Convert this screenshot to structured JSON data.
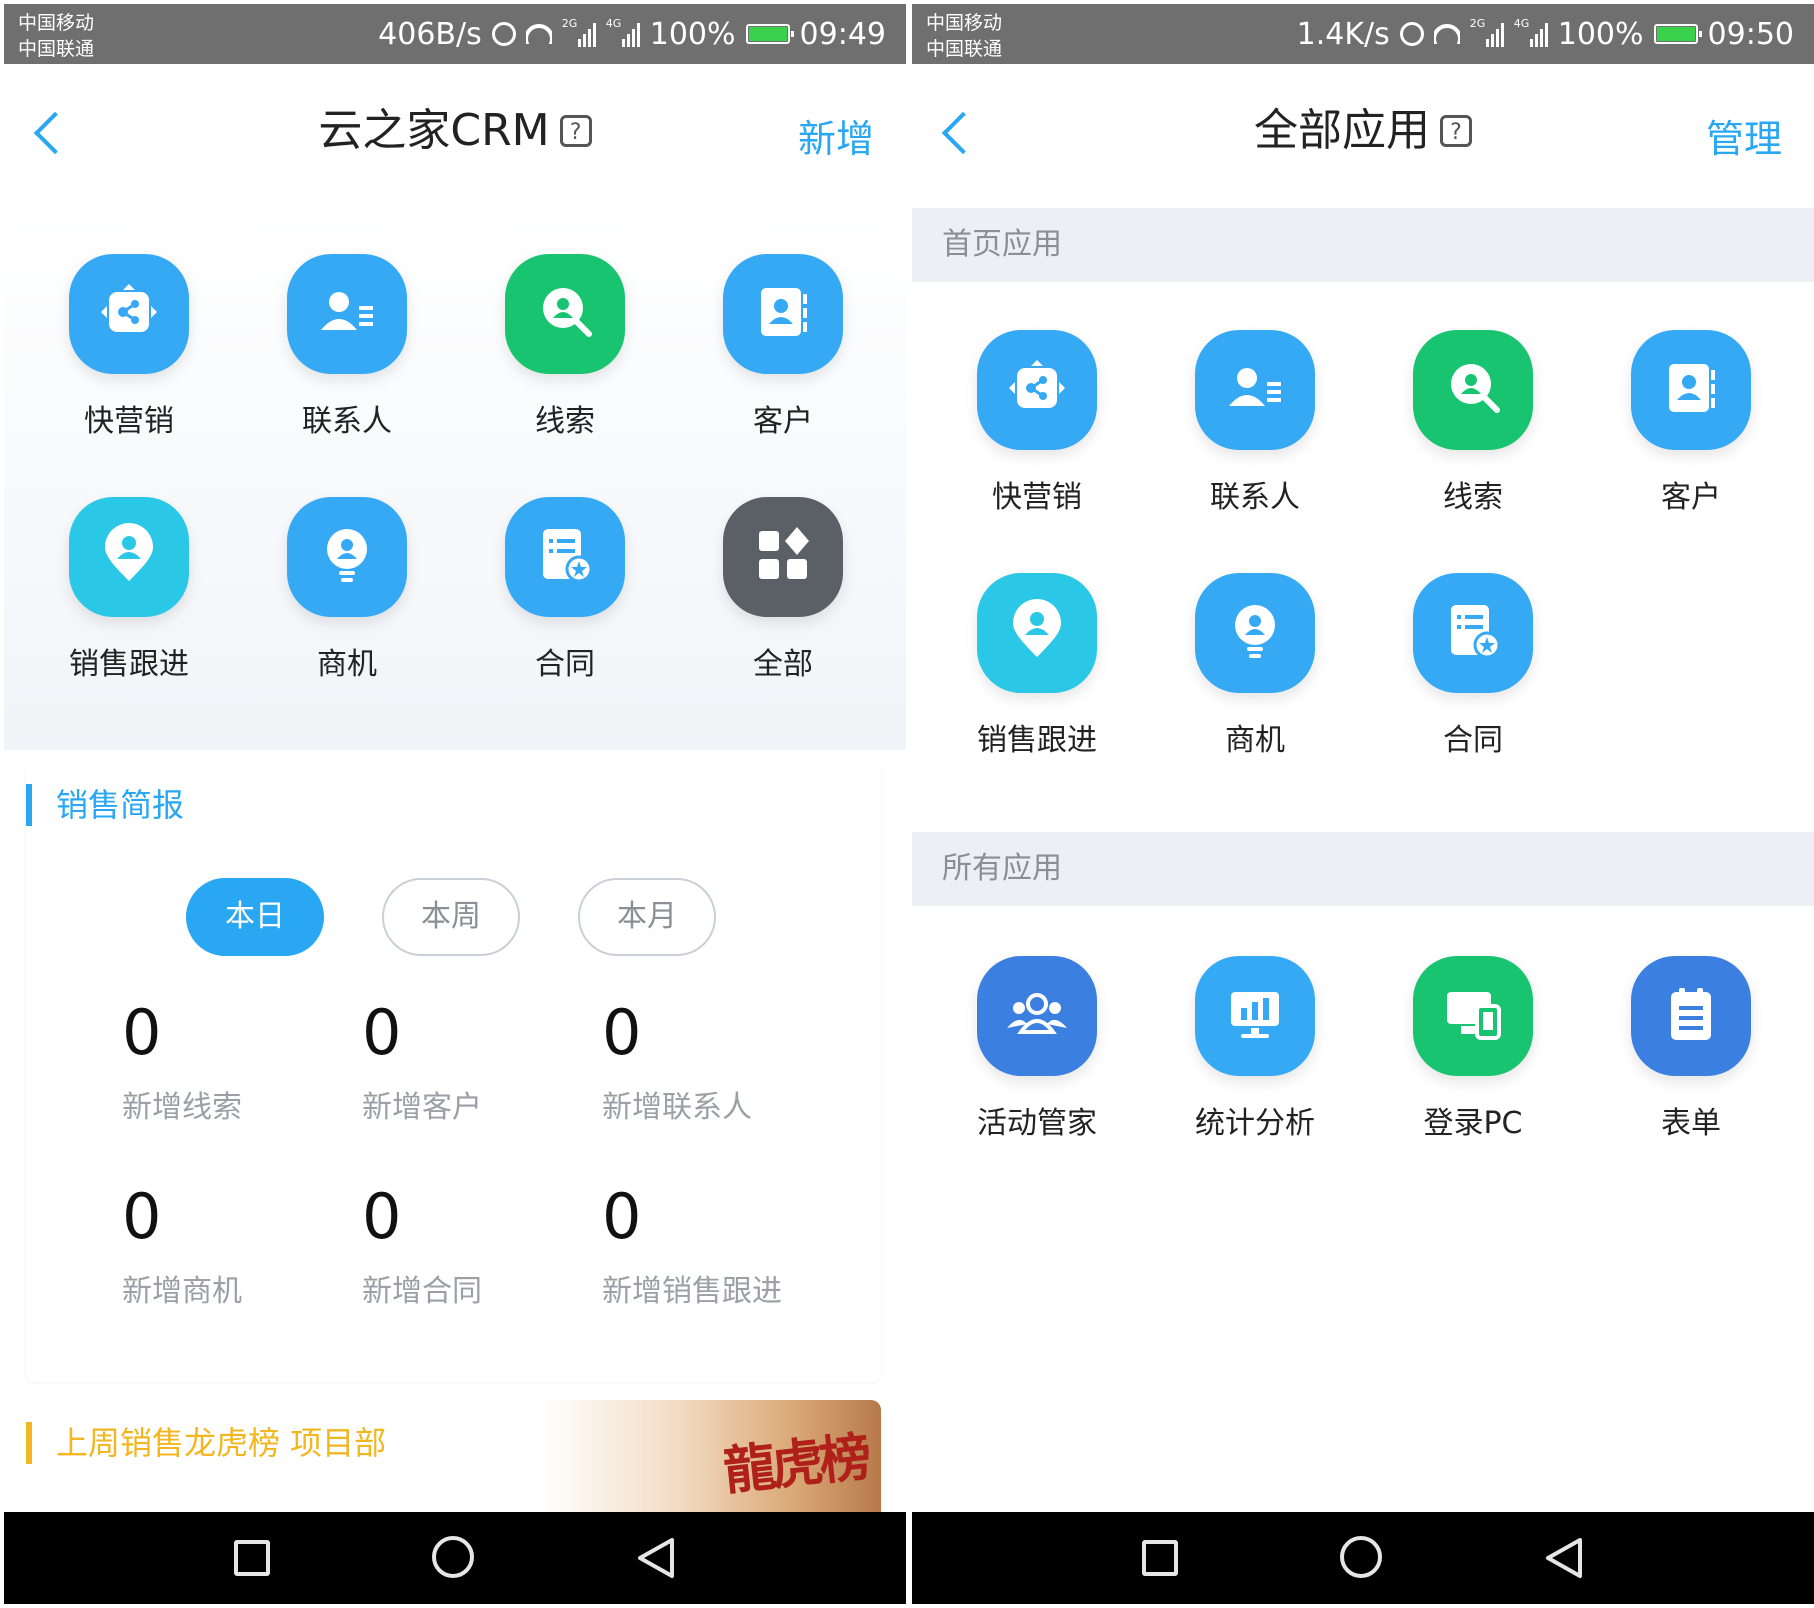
{
  "left": {
    "status": {
      "carrier1": "中国移动",
      "carrier2": "中国联通",
      "speed": "406B/s",
      "net1": "2G",
      "net2": "4G",
      "battery": "100%",
      "time": "09:49"
    },
    "header": {
      "title": "云之家CRM",
      "help": "?",
      "action": "新增"
    },
    "apps": [
      {
        "label": "快营销",
        "icon": "share-nodes-icon",
        "color": "#36a9f5"
      },
      {
        "label": "联系人",
        "icon": "contact-list-icon",
        "color": "#36a9f5"
      },
      {
        "label": "线索",
        "icon": "search-person-icon",
        "color": "#18c46f"
      },
      {
        "label": "客户",
        "icon": "address-book-icon",
        "color": "#36a9f5"
      },
      {
        "label": "销售跟进",
        "icon": "location-pin-icon",
        "color": "#2bc7e6"
      },
      {
        "label": "商机",
        "icon": "lightbulb-icon",
        "color": "#36a9f5"
      },
      {
        "label": "合同",
        "icon": "document-star-icon",
        "color": "#36a9f5"
      },
      {
        "label": "全部",
        "icon": "grid-apps-icon",
        "color": "#5b6066"
      }
    ],
    "brief": {
      "title": "销售简报",
      "accent": "#2aa7f2",
      "periods": [
        "本日",
        "本周",
        "本月"
      ],
      "stats": [
        {
          "value": "0",
          "label": "新增线索"
        },
        {
          "value": "0",
          "label": "新增客户"
        },
        {
          "value": "0",
          "label": "新增联系人"
        },
        {
          "value": "0",
          "label": "新增商机"
        },
        {
          "value": "0",
          "label": "新增合同"
        },
        {
          "value": "0",
          "label": "新增销售跟进"
        }
      ]
    },
    "ranking": {
      "title": "上周销售龙虎榜 项目部",
      "logo": "龍虎榜",
      "accent": "#f2b620"
    }
  },
  "right": {
    "status": {
      "carrier1": "中国移动",
      "carrier2": "中国联通",
      "speed": "1.4K/s",
      "net1": "2G",
      "net2": "4G",
      "battery": "100%",
      "time": "09:50"
    },
    "header": {
      "title": "全部应用",
      "help": "?",
      "action": "管理"
    },
    "home_section": "首页应用",
    "home_apps": [
      {
        "label": "快营销",
        "icon": "share-nodes-icon",
        "color": "#36a9f5"
      },
      {
        "label": "联系人",
        "icon": "contact-list-icon",
        "color": "#36a9f5"
      },
      {
        "label": "线索",
        "icon": "search-person-icon",
        "color": "#18c46f"
      },
      {
        "label": "客户",
        "icon": "address-book-icon",
        "color": "#36a9f5"
      },
      {
        "label": "销售跟进",
        "icon": "location-pin-icon",
        "color": "#2bc7e6"
      },
      {
        "label": "商机",
        "icon": "lightbulb-icon",
        "color": "#36a9f5"
      },
      {
        "label": "合同",
        "icon": "document-star-icon",
        "color": "#36a9f5"
      }
    ],
    "all_section": "所有应用",
    "all_apps": [
      {
        "label": "活动管家",
        "icon": "people-group-icon",
        "color": "#3b7fe0"
      },
      {
        "label": "统计分析",
        "icon": "bar-chart-icon",
        "color": "#36a9f5"
      },
      {
        "label": "登录PC",
        "icon": "devices-icon",
        "color": "#18c46f"
      },
      {
        "label": "表单",
        "icon": "clipboard-form-icon",
        "color": "#3b7fe0"
      }
    ]
  }
}
